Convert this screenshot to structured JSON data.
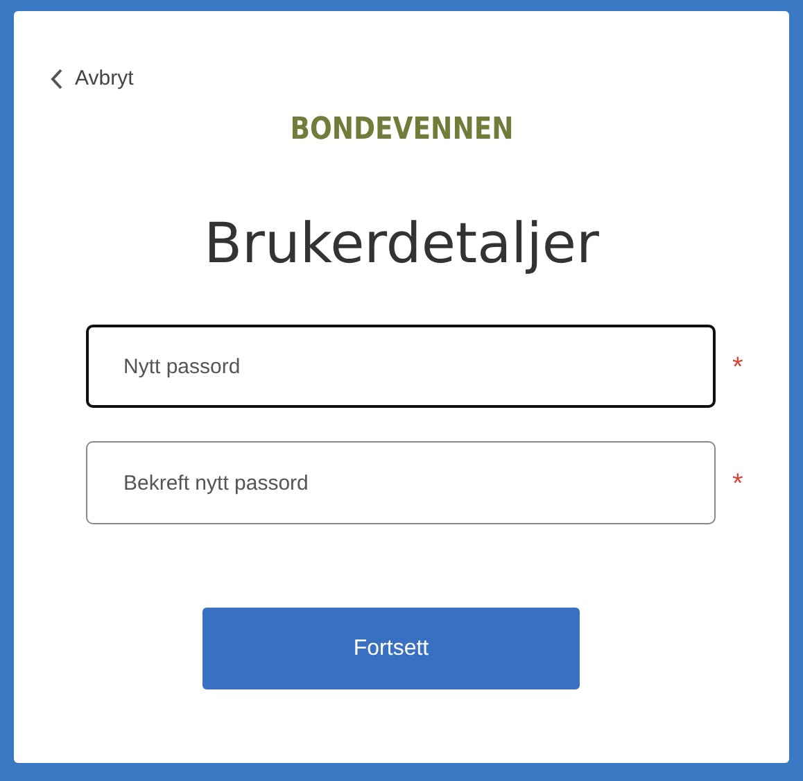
{
  "back_link": {
    "label": "Avbryt"
  },
  "logo": {
    "text": "BONDEVENNEN"
  },
  "title": "Brukerdetaljer",
  "fields": [
    {
      "placeholder": "Nytt passord",
      "focused": true,
      "required": true,
      "required_mark": "*"
    },
    {
      "placeholder": "Bekreft nytt passord",
      "focused": false,
      "required": true,
      "required_mark": "*"
    }
  ],
  "button": {
    "label": "Fortsett"
  }
}
